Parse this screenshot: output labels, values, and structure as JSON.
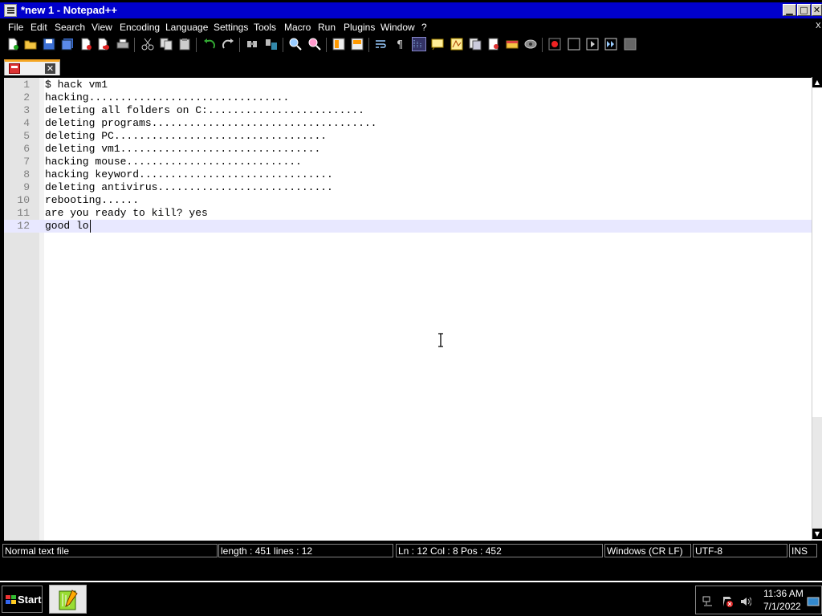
{
  "window": {
    "title": "*new 1 - Notepad++",
    "minimize_glyph": "▁",
    "maximize_glyph": "□",
    "close_glyph": "✕"
  },
  "menu": [
    "File",
    "Edit",
    "Search",
    "View",
    "Encoding",
    "Language",
    "Settings",
    "Tools",
    "Macro",
    "Run",
    "Plugins",
    "Window",
    "?"
  ],
  "menu_close_glyph": "X",
  "toolbar": {
    "icons": [
      "new-file-icon",
      "open-file-icon",
      "save-icon",
      "save-all-icon",
      "close-icon",
      "close-all-icon",
      "print-icon",
      "cut-icon",
      "copy-icon",
      "paste-icon",
      "undo-icon",
      "redo-icon",
      "find-icon",
      "replace-icon",
      "zoom-in-icon",
      "zoom-out-icon",
      "sync-vertical-icon",
      "sync-horizontal-icon",
      "word-wrap-icon",
      "show-all-chars-icon",
      "indent-guide-icon",
      "define-language-icon",
      "document-map-icon",
      "function-list-icon",
      "folder-workspace-icon",
      "monitoring-icon",
      "record-macro-icon",
      "stop-macro-icon",
      "play-macro-icon",
      "run-macro-multiple-icon",
      "save-macro-icon"
    ]
  },
  "tab": {
    "close_glyph": "✕"
  },
  "editor": {
    "lines": [
      "$ hack vm1",
      "hacking................................",
      "deleting all folders on C:.........................",
      "deleting programs....................................",
      "deleting PC..................................",
      "deleting vm1................................",
      "hacking mouse............................",
      "hacking keyword...............................",
      "deleting antivirus............................",
      "rebooting......",
      "are you ready to kill? yes",
      "good lo"
    ],
    "current_line": 12
  },
  "scrollbar": {
    "up_glyph": "▲",
    "down_glyph": "▼"
  },
  "status": {
    "file_type": "Normal text file",
    "length_lines": "length : 451    lines : 12",
    "position": "Ln : 12    Col : 8    Pos : 452",
    "eol": "Windows (CR LF)",
    "encoding": "UTF-8",
    "mode": "INS"
  },
  "taskbar": {
    "start_label": "Start",
    "time": "11:36 AM",
    "date": "7/1/2022"
  }
}
